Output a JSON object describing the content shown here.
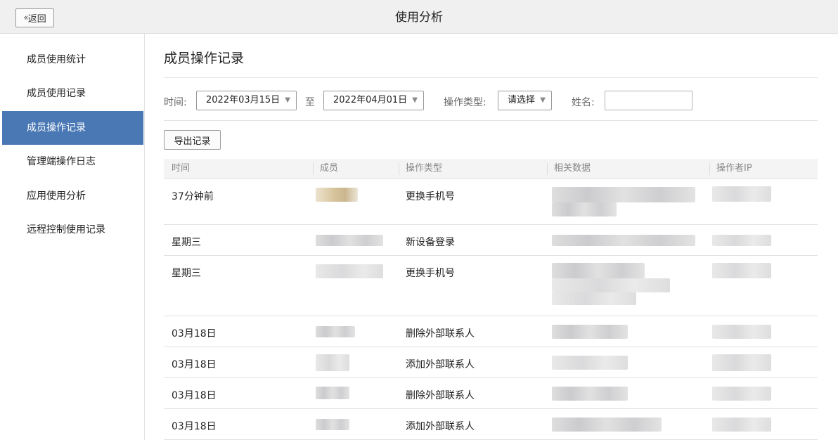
{
  "topbar": {
    "back_label": "返回",
    "back_icon": "double-chevron-left-icon",
    "title": "使用分析"
  },
  "sidebar": {
    "items": [
      {
        "label": "成员使用统计",
        "active": false
      },
      {
        "label": "成员使用记录",
        "active": false
      },
      {
        "label": "成员操作记录",
        "active": true
      },
      {
        "label": "管理端操作日志",
        "active": false
      },
      {
        "label": "应用使用分析",
        "active": false
      },
      {
        "label": "远程控制使用记录",
        "active": false
      }
    ]
  },
  "main": {
    "title": "成员操作记录",
    "filters": {
      "time_label": "时间:",
      "start_date": "2022年03月15日",
      "to_label": "至",
      "end_date": "2022年04月01日",
      "type_label": "操作类型:",
      "type_value": "请选择",
      "name_label": "姓名:",
      "name_value": ""
    },
    "export_label": "导出记录",
    "table": {
      "headers": [
        "时间",
        "成员",
        "操作类型",
        "相关数据",
        "操作者IP"
      ],
      "rows": [
        {
          "time": "37分钟前",
          "type": "更换手机号"
        },
        {
          "time": "星期三",
          "type": "新设备登录"
        },
        {
          "time": "星期三",
          "type": "更换手机号"
        },
        {
          "time": "03月18日",
          "type": "删除外部联系人"
        },
        {
          "time": "03月18日",
          "type": "添加外部联系人"
        },
        {
          "time": "03月18日",
          "type": "删除外部联系人"
        },
        {
          "time": "03月18日",
          "type": "添加外部联系人"
        }
      ]
    }
  },
  "colors": {
    "active_sidebar": "#4a78b4",
    "topbar_bg": "#f0f0f0"
  }
}
